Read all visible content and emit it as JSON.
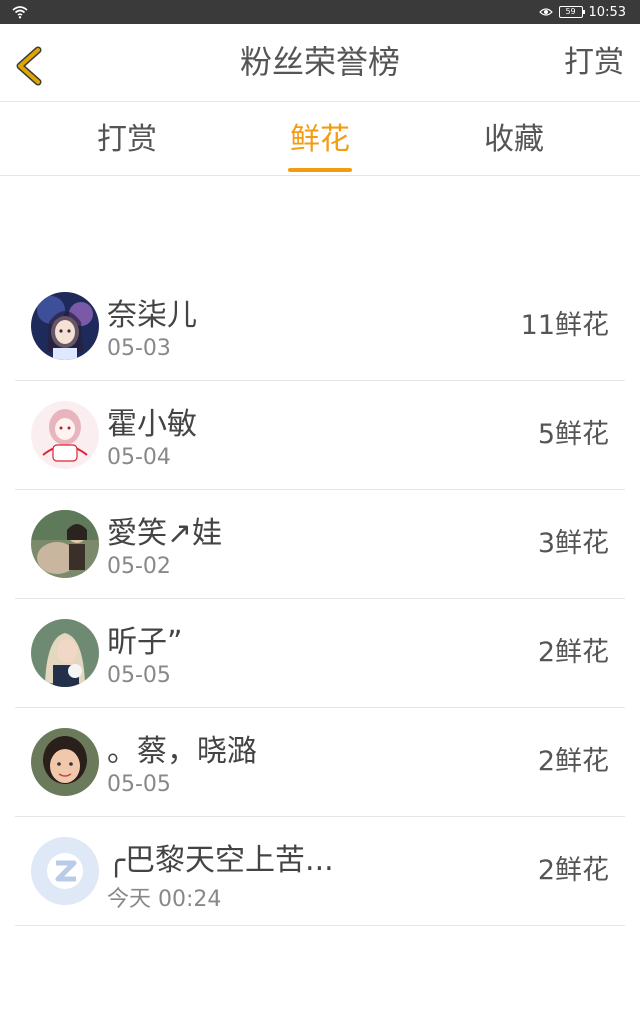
{
  "statusbar": {
    "time": "10:53",
    "battery": "59"
  },
  "header": {
    "title": "粉丝荣誉榜",
    "action": "打赏"
  },
  "tabs": [
    {
      "label": "打赏"
    },
    {
      "label": "鲜花"
    },
    {
      "label": "收藏"
    }
  ],
  "active_tab": "鲜花",
  "colors": {
    "accent": "#f39c12",
    "back_arrow": "#e0a600"
  },
  "fans": [
    {
      "name": "奈柒儿",
      "date": "05-03",
      "count": "11鲜花"
    },
    {
      "name": "霍小敏",
      "date": "05-04",
      "count": "5鲜花"
    },
    {
      "name": "愛笑↗娃",
      "date": "05-02",
      "count": "3鲜花"
    },
    {
      "name": "昕子”",
      "date": "05-05",
      "count": "2鲜花"
    },
    {
      "name": "。蔡，晓潞",
      "date": "05-05",
      "count": "2鲜花"
    },
    {
      "name": "╭巴黎天空上苦...",
      "date": "今天 00:24",
      "count": "2鲜花"
    }
  ]
}
